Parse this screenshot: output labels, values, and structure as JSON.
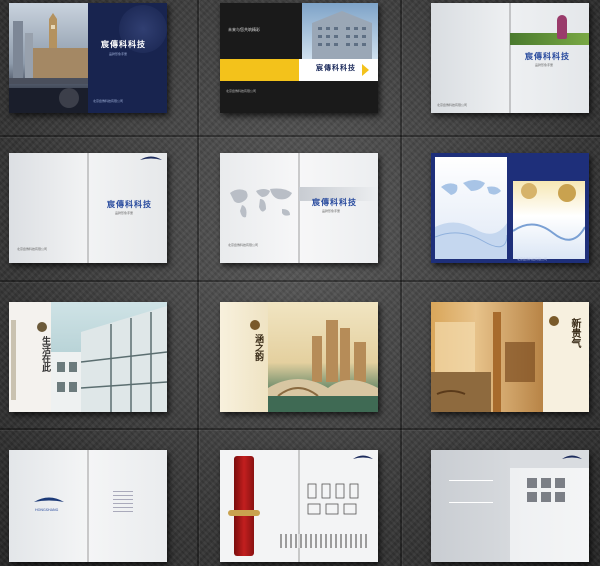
{
  "brand": "宸傳科科技",
  "brand_sub": "品牌形象手册",
  "company_cn": "北京宸傳科技有限公司",
  "company_en": "Beijing HongShang Technology Co.,Ltd.",
  "tagline": "未来与您共筑精彩",
  "logo_text": "HONGSHANG",
  "vert_1": "生活在此",
  "vert_2": "涵之韵",
  "vert_3": "新贵气",
  "colors": {
    "navy": "#1c2b5c",
    "yellow": "#f3c21b",
    "blue": "#2a4c9f"
  }
}
